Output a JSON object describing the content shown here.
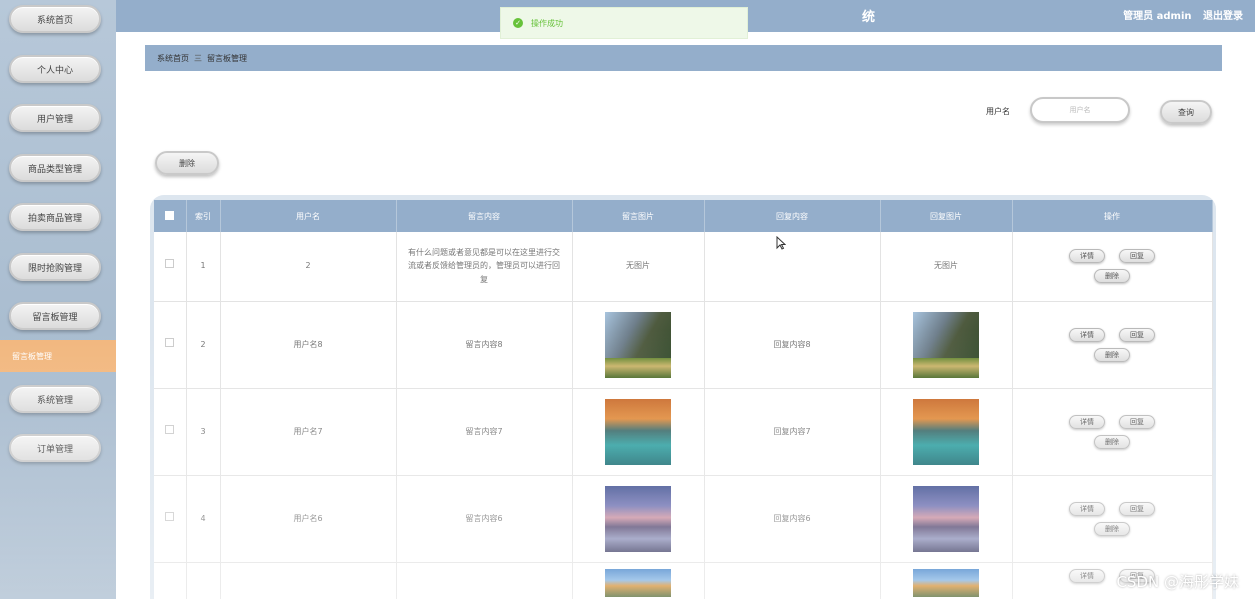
{
  "sidebar": {
    "items": [
      {
        "label": "系统首页"
      },
      {
        "label": "个人中心"
      },
      {
        "label": "用户管理"
      },
      {
        "label": "商品类型管理"
      },
      {
        "label": "拍卖商品管理"
      },
      {
        "label": "限时抢购管理"
      },
      {
        "label": "留言板管理"
      },
      {
        "label": "系统管理"
      },
      {
        "label": "订单管理"
      }
    ],
    "active_sub": "留言板管理"
  },
  "header": {
    "title_fragment": "统",
    "user": "管理员 admin",
    "logout": "退出登录",
    "bg_color": "#94aecb"
  },
  "toast": {
    "message": "操作成功",
    "color": "#67c23a"
  },
  "breadcrumb": {
    "home": "系统首页",
    "separator": "三",
    "current": "留言板管理"
  },
  "search": {
    "label": "用户名",
    "placeholder": "用户名",
    "button": "查询"
  },
  "toolbar": {
    "delete": "删除"
  },
  "table": {
    "headers": [
      "索引",
      "用户名",
      "留言内容",
      "留言图片",
      "回复内容",
      "回复图片",
      "操作"
    ],
    "actions": {
      "detail": "详情",
      "reply": "回复",
      "delete": "删除"
    },
    "rows": [
      {
        "index": "1",
        "username": "2",
        "content": "有什么问题或者意见都是可以在这里进行交流或者反馈给管理员的，管理员可以进行回复",
        "image_text": "无图片",
        "reply": "",
        "reply_image_text": "无图片"
      },
      {
        "index": "2",
        "username": "用户名8",
        "content": "留言内容8",
        "image": "mountain",
        "reply": "回复内容8",
        "reply_image": "mountain"
      },
      {
        "index": "3",
        "username": "用户名7",
        "content": "留言内容7",
        "image": "lake",
        "reply": "回复内容7",
        "reply_image": "lake"
      },
      {
        "index": "4",
        "username": "用户名6",
        "content": "留言内容6",
        "image": "sunset",
        "reply": "回复内容6",
        "reply_image": "sunset"
      },
      {
        "index": "",
        "username": "",
        "content": "",
        "image": "autumn",
        "reply": "",
        "reply_image": "autumn"
      }
    ]
  },
  "watermark": "CSDN @海彤学妹"
}
